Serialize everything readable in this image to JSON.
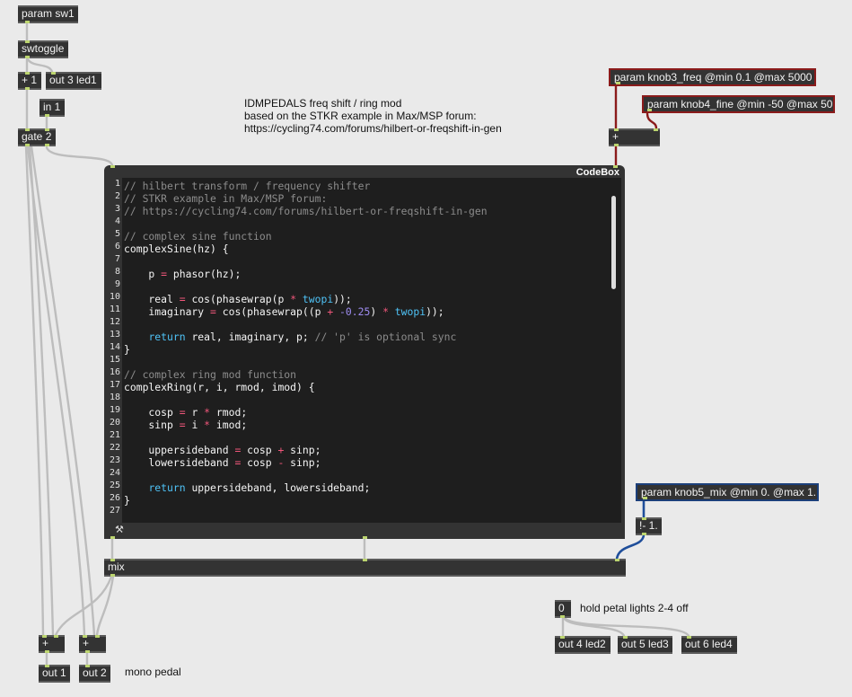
{
  "objects": {
    "param_sw1": "param sw1",
    "swtoggle": "swtoggle",
    "plus1": "+ 1",
    "out3": "out 3 led1",
    "in1": "in 1",
    "gate2": "gate 2",
    "knob3": "param knob3_freq @min 0.1 @max 5000",
    "knob4": "param knob4_fine @min -50 @max 50",
    "plus_knob": "+",
    "knob5": "param knob5_mix @min 0. @max 1.",
    "rminus": "!- 1.",
    "mix": "mix",
    "plus_a": "+",
    "plus_b": "+",
    "out1": "out 1",
    "out2": "out 2",
    "zero": "0",
    "out4": "out 4 led2",
    "out5": "out 5 led3",
    "out6": "out 6 led4"
  },
  "comments": {
    "header_line1": "IDMPEDALS freq shift / ring mod",
    "header_line2": "based on the STKR example in Max/MSP forum:",
    "header_line3": "https://cycling74.com/forums/hilbert-or-freqshift-in-gen",
    "hold_lights": "hold petal lights 2-4 off",
    "mono_pedal": "mono pedal"
  },
  "codebox": {
    "title": "CodeBox",
    "line_numbers": [
      "1",
      "2",
      "3",
      "4",
      "5",
      "6",
      "7",
      "8",
      "9",
      "10",
      "11",
      "12",
      "13",
      "14",
      "15",
      "16",
      "17",
      "18",
      "19",
      "20",
      "21",
      "22",
      "23",
      "24",
      "25",
      "26",
      "27"
    ],
    "lines": [
      "// hilbert transform / frequency shifter",
      "// STKR example in Max/MSP forum:",
      "// https://cycling74.com/forums/hilbert-or-freqshift-in-gen",
      "",
      "// complex sine function",
      "complexSine(hz) {",
      "",
      "    p = phasor(hz);",
      "",
      "    real = cos(phasewrap(p * twopi));",
      "    imaginary = cos(phasewrap((p + -0.25) * twopi));",
      "",
      "    return real, imaginary, p; // 'p' is optional sync",
      "}",
      "",
      "// complex ring mod function",
      "complexRing(r, i, rmod, imod) {",
      "",
      "    cosp = r * rmod;",
      "    sinp = i * imod;",
      "",
      "    uppersideband = cosp + sinp;",
      "    lowersideband = cosp - sinp;",
      "",
      "    return uppersideband, lowersideband;",
      "}",
      ""
    ]
  },
  "colors": {
    "canvas": "#eaeaea",
    "object": "#333333",
    "param_border": "#8b1b1b",
    "mix_param_border": "#1c3f7a",
    "cable": "#bdbdbd",
    "signal_cable": "#1f4e9a",
    "cable_red": "#8b1b1b",
    "port": "#bcd56f"
  }
}
